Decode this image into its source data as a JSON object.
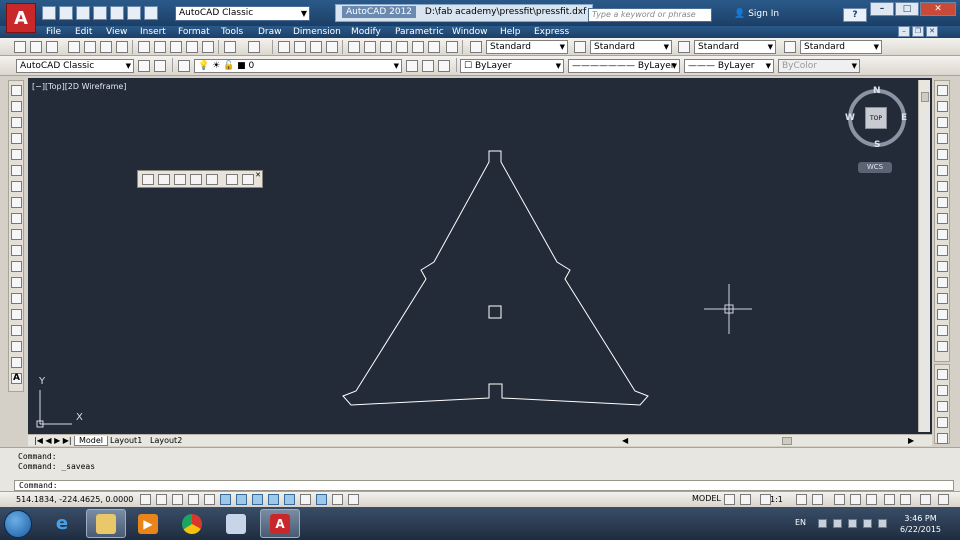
{
  "app": {
    "logo_letter": "A",
    "title_app": "AutoCAD 2012",
    "title_doc": "D:\\fab academy\\pressfit\\pressfit.dxf",
    "workspace": "AutoCAD Classic",
    "search_placeholder": "Type a keyword or phrase",
    "sign_in": "Sign In",
    "help": "?"
  },
  "menu": [
    "File",
    "Edit",
    "View",
    "Insert",
    "Format",
    "Tools",
    "Draw",
    "Dimension",
    "Modify",
    "Parametric",
    "Window",
    "Help",
    "Express"
  ],
  "styles_toolbar": {
    "text_style": "Standard",
    "dim_style": "Standard",
    "table_style": "Standard",
    "multileader_style": "Standard"
  },
  "layers_toolbar": {
    "workspace": "AutoCAD Classic",
    "layer": "0",
    "color": "ByLayer",
    "linetype": "ByLayer",
    "lineweight": "ByLayer",
    "plotstyle": "ByColor"
  },
  "viewport": {
    "label": "[−][Top][2D Wireframe]",
    "axis_y": "Y",
    "axis_x": "X"
  },
  "viewcube": {
    "north": "N",
    "south": "S",
    "east": "E",
    "west": "W",
    "top": "TOP",
    "wcs": "WCS"
  },
  "layout_tabs": [
    "Model",
    "Layout1",
    "Layout2"
  ],
  "command": {
    "history": [
      "Command:",
      "Command: _saveas"
    ],
    "prompt": "Command:"
  },
  "status": {
    "coords": "514.1834, -224.4625, 0.0000",
    "model": "MODEL",
    "scale": "1:1"
  },
  "taskbar": {
    "language": "EN",
    "time": "3:46 PM",
    "date": "6/22/2015"
  },
  "colors": {
    "canvas_bg": "#232b38",
    "title_bar": "#1c3f66",
    "autocad_red": "#c8282a",
    "line_color": "#ffffff"
  }
}
